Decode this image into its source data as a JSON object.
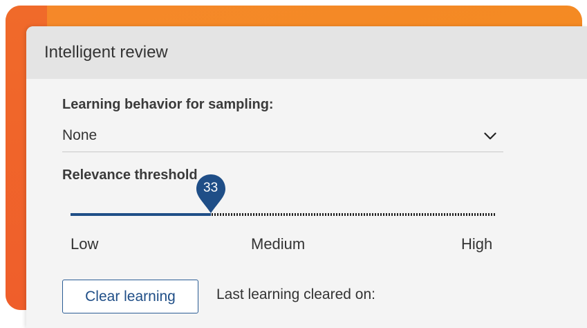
{
  "panel": {
    "title": "Intelligent review"
  },
  "sampling": {
    "label": "Learning behavior for sampling:",
    "selected_value": "None",
    "dropdown_icon": "chevron-down-icon"
  },
  "relevance": {
    "label": "Relevance threshold",
    "value": 33,
    "value_label": "33",
    "min": 0,
    "max": 100,
    "scale": {
      "low": "Low",
      "medium": "Medium",
      "high": "High"
    }
  },
  "actions": {
    "clear_label": "Clear learning",
    "last_cleared_text": "Last learning cleared on:"
  },
  "colors": {
    "accent": "#1f4e87",
    "frame_orange": "#f48a22",
    "panel_bg": "#f4f4f4",
    "header_bg": "#e4e4e4"
  }
}
